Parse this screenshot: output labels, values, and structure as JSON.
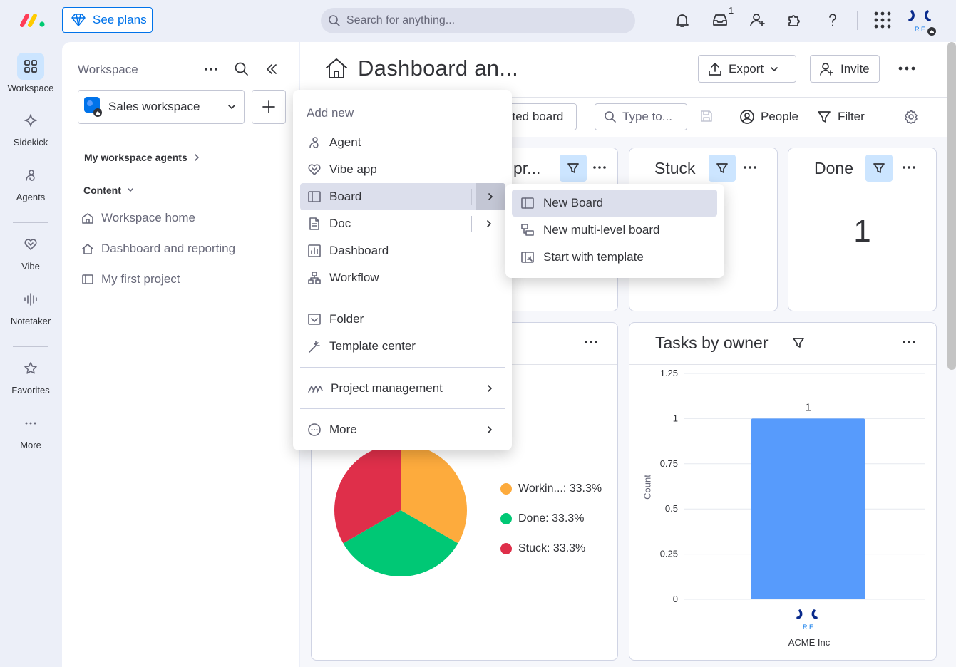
{
  "topbar": {
    "see_plans": "See plans",
    "search_placeholder": "Search for anything...",
    "inbox_count": "1",
    "avatar_initials": "R E"
  },
  "rail": {
    "items": [
      {
        "label": "Workspace",
        "icon": "grid-icon"
      },
      {
        "label": "Sidekick",
        "icon": "sparkle-icon"
      },
      {
        "label": "Agents",
        "icon": "agent-icon"
      },
      {
        "label": "Vibe",
        "icon": "heart-icon"
      },
      {
        "label": "Notetaker",
        "icon": "audio-wave-icon"
      },
      {
        "label": "Favorites",
        "icon": "star-icon"
      },
      {
        "label": "More",
        "icon": "more-dots-icon"
      }
    ]
  },
  "workspace_panel": {
    "title": "Workspace",
    "selected_workspace": "Sales workspace",
    "agents_section": "My workspace agents",
    "content_section": "Content",
    "links": [
      {
        "label": "Workspace home",
        "icon": "workspace-home-icon"
      },
      {
        "label": "Dashboard and reporting",
        "icon": "home-icon"
      },
      {
        "label": "My first project",
        "icon": "board-icon"
      }
    ]
  },
  "header": {
    "title": "Dashboard an...",
    "export": "Export",
    "invite": "Invite"
  },
  "toolbar": {
    "connected_board": "cted board",
    "type_placeholder": "Type to...",
    "people": "People",
    "filter": "Filter"
  },
  "widgets": {
    "w1_title": "pr...",
    "stuck_title": "Stuck",
    "done_title": "Done",
    "done_value": "1",
    "tasks_title": "Tasks by owner"
  },
  "dropdown": {
    "header": "Add new",
    "items": [
      "Agent",
      "Vibe app",
      "Board",
      "Doc",
      "Dashboard",
      "Workflow",
      "Folder",
      "Template center",
      "Project management",
      "More"
    ]
  },
  "submenu": {
    "items": [
      "New Board",
      "New multi-level board",
      "Start with template"
    ]
  },
  "colors": {
    "accent": "#0073ea",
    "working": "#fdab3d",
    "done": "#00c875",
    "stuck": "#df2f4a",
    "bar": "#579bfc"
  },
  "chart_data": [
    {
      "type": "pie",
      "labels": [
        "Workin...: 33.3%",
        "Done: 33.3%",
        "Stuck: 33.3%"
      ],
      "values": [
        33.3,
        33.3,
        33.3
      ],
      "colors": [
        "#fdab3d",
        "#00c875",
        "#df2f4a"
      ],
      "legend": "right"
    },
    {
      "type": "bar",
      "title": "Tasks by owner",
      "categories": [
        "ACME Inc"
      ],
      "values": [
        1
      ],
      "ylabel": "Count",
      "ylim": [
        0,
        1.25
      ],
      "yticks": [
        "1.25",
        "1",
        "0.75",
        "0.5",
        "0.25",
        "0"
      ],
      "data_label": "1",
      "grid": true
    }
  ]
}
